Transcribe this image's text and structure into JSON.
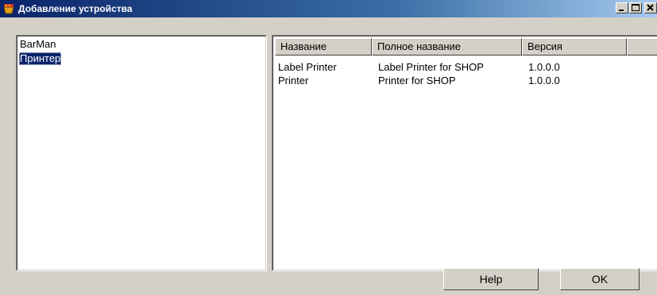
{
  "window": {
    "title": "Добавление устройства",
    "app_icon": "shop-app-icon",
    "controls": [
      "minimize-icon",
      "maximize-icon",
      "close-icon"
    ]
  },
  "device_list": {
    "items": [
      {
        "label": "BarMan",
        "selected": false
      },
      {
        "label": "Принтер",
        "selected": true
      }
    ]
  },
  "driver_table": {
    "columns": [
      "Название",
      "Полное название",
      "Версия",
      ""
    ],
    "rows": [
      {
        "name": "Label Printer",
        "full_name": "Label Printer for SHOP",
        "version": "1.0.0.0"
      },
      {
        "name": "Printer",
        "full_name": "Printer for SHOP",
        "version": "1.0.0.0"
      }
    ]
  },
  "buttons": {
    "help_label": "Help",
    "ok_label": "OK"
  },
  "colors": {
    "title_start": "#0a246a",
    "title_end": "#a6caf0",
    "selection": "#0a246a",
    "face": "#d4d0c8"
  }
}
